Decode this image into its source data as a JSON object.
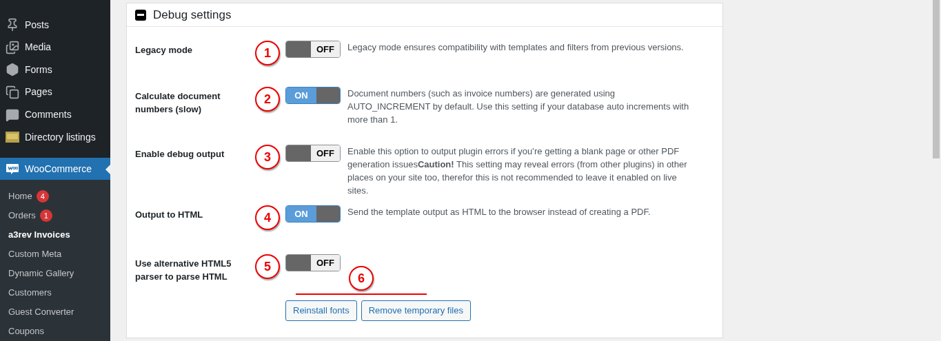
{
  "sidebar": {
    "items": [
      {
        "label": "Posts",
        "kind": "pin"
      },
      {
        "label": "Media",
        "kind": "media"
      },
      {
        "label": "Forms",
        "kind": "forms"
      },
      {
        "label": "Pages",
        "kind": "pages"
      },
      {
        "label": "Comments",
        "kind": "comments"
      },
      {
        "label": "Directory listings",
        "kind": "directory"
      }
    ],
    "active": {
      "label": "WooCommerce"
    },
    "submenu": [
      {
        "label": "Home",
        "badge": "4",
        "selected": false
      },
      {
        "label": "Orders",
        "badge": "1",
        "selected": false
      },
      {
        "label": "a3rev Invoices",
        "selected": true
      },
      {
        "label": "Custom Meta",
        "selected": false
      },
      {
        "label": "Dynamic Gallery",
        "selected": false
      },
      {
        "label": "Customers",
        "selected": false
      },
      {
        "label": "Guest Converter",
        "selected": false
      },
      {
        "label": "Coupons",
        "selected": false
      }
    ]
  },
  "panel": {
    "title": "Debug settings",
    "expanded": true,
    "settings": [
      {
        "label": "Legacy mode",
        "marker": "1",
        "on": false,
        "toggle_text": "OFF",
        "description": "Legacy mode ensures compatibility with templates and filters from previous versions."
      },
      {
        "label": "Calculate document numbers (slow)",
        "marker": "2",
        "on": true,
        "toggle_text": "ON",
        "description": "Document numbers (such as invoice numbers) are generated using AUTO_INCREMENT by default. Use this setting if your database auto increments with more than 1."
      },
      {
        "label": "Enable debug output",
        "marker": "3",
        "on": false,
        "toggle_text": "OFF",
        "description": "Enable this option to output plugin errors if you’re getting a blank page or other PDF generation issues**Caution!** This setting may reveal errors (from other plugins) in other places on your site too, therefor this is not recommended to leave it enabled on live sites."
      },
      {
        "label": "Output to HTML",
        "marker": "4",
        "on": true,
        "toggle_text": "ON",
        "description": "Send the template output as HTML to the browser instead of creating a PDF."
      },
      {
        "label": "Use alternative HTML5 parser to parse HTML",
        "marker": "5",
        "on": false,
        "toggle_text": "OFF"
      }
    ],
    "tools_marker": "6",
    "buttons": [
      "Reinstall fonts",
      "Remove temporary files"
    ]
  }
}
